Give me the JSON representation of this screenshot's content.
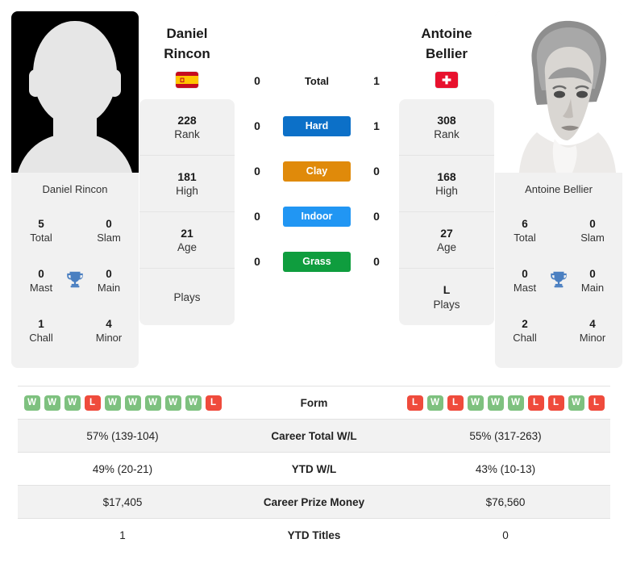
{
  "players": {
    "left": {
      "name_line1": "Daniel",
      "name_line2": "Rincon",
      "full_name": "Daniel Rincon",
      "country": "Spain",
      "flag_icon": "flag-spain",
      "photo_type": "silhouette-placeholder",
      "info": [
        {
          "value": "228",
          "label": "Rank"
        },
        {
          "value": "181",
          "label": "High"
        },
        {
          "value": "21",
          "label": "Age"
        },
        {
          "value": "",
          "label": "Plays"
        }
      ],
      "titles": {
        "total": {
          "value": "5",
          "label": "Total"
        },
        "slam": {
          "value": "0",
          "label": "Slam"
        },
        "mast": {
          "value": "0",
          "label": "Mast"
        },
        "main": {
          "value": "0",
          "label": "Main"
        },
        "chall": {
          "value": "1",
          "label": "Chall"
        },
        "minor": {
          "value": "4",
          "label": "Minor"
        }
      },
      "form": [
        "W",
        "W",
        "W",
        "L",
        "W",
        "W",
        "W",
        "W",
        "W",
        "L"
      ],
      "career_total_wl": "57% (139-104)",
      "ytd_wl": "49% (20-21)",
      "career_prize_money": "$17,405",
      "ytd_titles": "1"
    },
    "right": {
      "name_line1": "Antoine",
      "name_line2": "Bellier",
      "full_name": "Antoine Bellier",
      "country": "Switzerland",
      "flag_icon": "flag-switzerland",
      "photo_type": "portrait-photo",
      "info": [
        {
          "value": "308",
          "label": "Rank"
        },
        {
          "value": "168",
          "label": "High"
        },
        {
          "value": "27",
          "label": "Age"
        },
        {
          "value": "L",
          "label": "Plays"
        }
      ],
      "titles": {
        "total": {
          "value": "6",
          "label": "Total"
        },
        "slam": {
          "value": "0",
          "label": "Slam"
        },
        "mast": {
          "value": "0",
          "label": "Mast"
        },
        "main": {
          "value": "0",
          "label": "Main"
        },
        "chall": {
          "value": "2",
          "label": "Chall"
        },
        "minor": {
          "value": "4",
          "label": "Minor"
        }
      },
      "form": [
        "L",
        "W",
        "L",
        "W",
        "W",
        "W",
        "L",
        "L",
        "W",
        "L"
      ],
      "career_total_wl": "55% (317-263)",
      "ytd_wl": "43% (10-13)",
      "career_prize_money": "$76,560",
      "ytd_titles": "0"
    }
  },
  "head_to_head": [
    {
      "surface": "Total",
      "left": "0",
      "right": "1",
      "color": ""
    },
    {
      "surface": "Hard",
      "left": "0",
      "right": "1",
      "color": "#0c70c8"
    },
    {
      "surface": "Clay",
      "left": "0",
      "right": "0",
      "color": "#e08a0a"
    },
    {
      "surface": "Indoor",
      "left": "0",
      "right": "0",
      "color": "#2196f3"
    },
    {
      "surface": "Grass",
      "left": "0",
      "right": "0",
      "color": "#0f9d3e"
    }
  ],
  "table": {
    "rows": [
      {
        "label": "Form",
        "type": "form"
      },
      {
        "label": "Career Total W/L",
        "type": "text",
        "key": "career_total_wl"
      },
      {
        "label": "YTD W/L",
        "type": "text",
        "key": "ytd_wl"
      },
      {
        "label": "Career Prize Money",
        "type": "text",
        "key": "career_prize_money"
      },
      {
        "label": "YTD Titles",
        "type": "text",
        "key": "ytd_titles"
      }
    ]
  },
  "colors": {
    "hard": "#0c70c8",
    "clay": "#e08a0a",
    "indoor": "#2196f3",
    "grass": "#0f9d3e",
    "win_badge": "#7ec17f",
    "loss_badge": "#ef4b3c",
    "card_bg": "#f1f1f1",
    "row_shade": "#f2f2f2"
  }
}
